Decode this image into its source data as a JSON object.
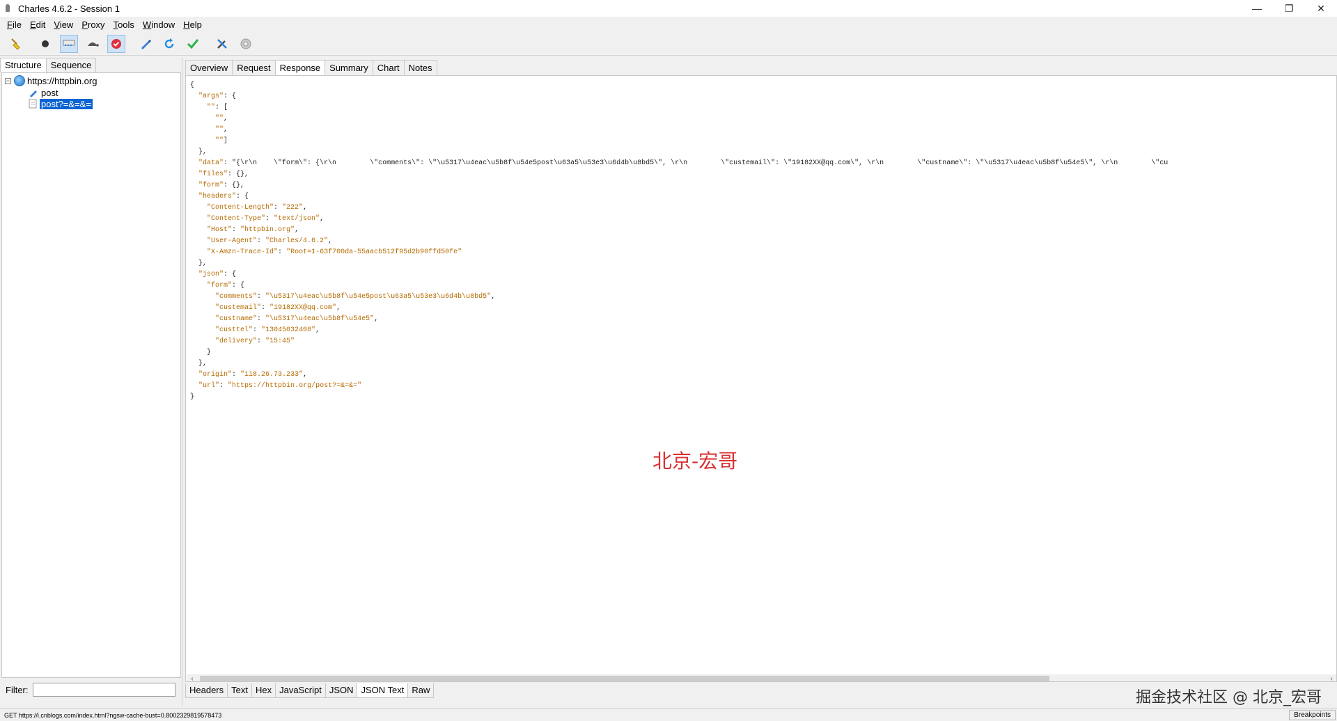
{
  "window": {
    "title": "Charles 4.6.2 - Session 1",
    "controls": {
      "minimize": "—",
      "restore": "❐",
      "close": "✕"
    }
  },
  "menu": [
    {
      "mn": "F",
      "rest": "ile"
    },
    {
      "mn": "E",
      "rest": "dit"
    },
    {
      "mn": "V",
      "rest": "iew"
    },
    {
      "mn": "P",
      "rest": "roxy"
    },
    {
      "mn": "T",
      "rest": "ools"
    },
    {
      "mn": "W",
      "rest": "indow"
    },
    {
      "mn": "H",
      "rest": "elp"
    }
  ],
  "toolbar_icons": [
    "broom-icon",
    "record-icon",
    "throttle-icon",
    "turtle-icon",
    "breakpoint-icon",
    "compose-icon",
    "repeat-icon",
    "validate-icon",
    "tools-icon",
    "settings-icon"
  ],
  "left": {
    "tabs": [
      "Structure",
      "Sequence"
    ],
    "tree": {
      "host": "https://httpbin.org",
      "children": [
        "post",
        "post?=&=&="
      ]
    },
    "filter_label": "Filter:",
    "filter_value": ""
  },
  "right": {
    "tabs": [
      "Overview",
      "Request",
      "Response",
      "Summary",
      "Chart",
      "Notes"
    ],
    "bottom_tabs": [
      "Headers",
      "Text",
      "Hex",
      "JavaScript",
      "JSON",
      "JSON Text",
      "Raw"
    ]
  },
  "json_lines": [
    "{",
    "  \"args\": {",
    "    \"\": [",
    "      \"\",",
    "      \"\",",
    "      \"\"]",
    "  },",
    "  \"data\": \"{\\r\\n    \\\"form\\\": {\\r\\n        \\\"comments\\\": \\\"\\u5317\\u4eac\\u5b8f\\u54e5post\\u63a5\\u53e3\\u6d4b\\u8bd5\\\", \\r\\n        \\\"custemail\\\": \\\"19182XX@qq.com\\\", \\r\\n        \\\"custname\\\": \\\"\\u5317\\u4eac\\u5b8f\\u54e5\\\", \\r\\n        \\\"cu",
    "  \"files\": {},",
    "  \"form\": {},",
    "  \"headers\": {",
    "    \"Content-Length\": \"222\",",
    "    \"Content-Type\": \"text/json\",",
    "    \"Host\": \"httpbin.org\",",
    "    \"User-Agent\": \"Charles/4.6.2\",",
    "    \"X-Amzn-Trace-Id\": \"Root=1-63f700da-55aacb512f95d2b90ffd50fe\"",
    "  },",
    "  \"json\": {",
    "    \"form\": {",
    "      \"comments\": \"\\u5317\\u4eac\\u5b8f\\u54e5post\\u63a5\\u53e3\\u6d4b\\u8bd5\",",
    "      \"custemail\": \"19182XX@qq.com\",",
    "      \"custname\": \"\\u5317\\u4eac\\u5b8f\\u54e5\",",
    "      \"custtel\": \"13045032408\",",
    "      \"delivery\": \"15:45\"",
    "    }",
    "  },",
    "  \"origin\": \"118.26.73.233\",",
    "  \"url\": \"https://httpbin.org/post?=&=&=\"",
    "}"
  ],
  "watermark_center": "北京-宏哥",
  "watermark_corner": "掘金技术社区 @ 北京_宏哥",
  "status": {
    "left": "GET https://i.cnblogs.com/index.html?ngsw-cache-bust=0.8002329819578473",
    "right": "Breakpoints"
  },
  "colors": {
    "selection": "#0a64d2",
    "json_string": "#b56a00",
    "watermark": "#d83131"
  }
}
